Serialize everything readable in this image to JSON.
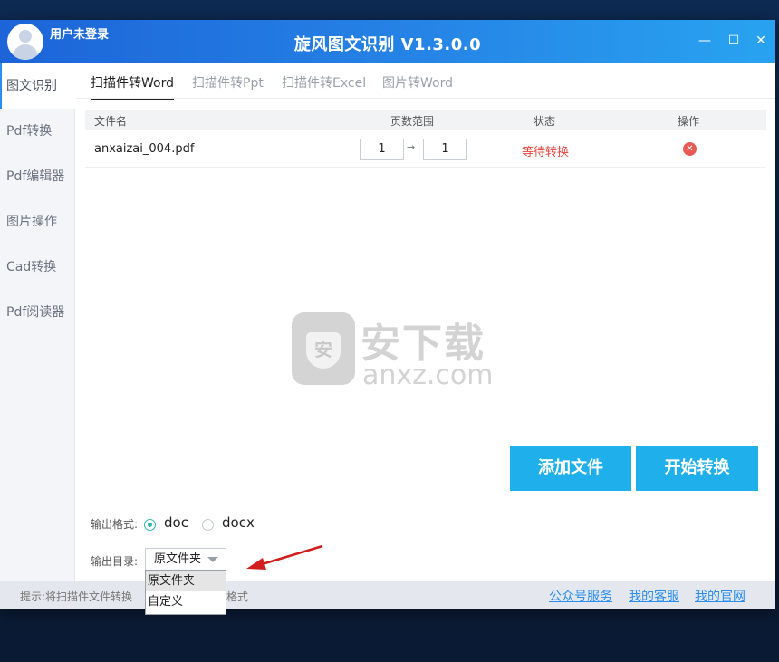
{
  "titlebar": {
    "user_name": "用户未登录",
    "app_title": "旋风图文识别 V1.3.0.0",
    "minimize_glyph": "—",
    "maximize_glyph": "☐",
    "close_glyph": "✕"
  },
  "sidebar": {
    "items": [
      {
        "label": "图文识别",
        "active": true
      },
      {
        "label": "Pdf转换"
      },
      {
        "label": "Pdf编辑器"
      },
      {
        "label": "图片操作"
      },
      {
        "label": "Cad转换"
      },
      {
        "label": "Pdf阅读器"
      }
    ]
  },
  "tabs": [
    {
      "label": "扫描件转Word",
      "active": true
    },
    {
      "label": "扫描件转Ppt"
    },
    {
      "label": "扫描件转Excel"
    },
    {
      "label": "图片转Word"
    }
  ],
  "table": {
    "columns": [
      "文件名",
      "页数范围",
      "状态",
      "操作"
    ],
    "rows": [
      {
        "file": "anxaizai_004.pdf",
        "page_from": "1",
        "page_to": "1",
        "status": "等待转换"
      }
    ]
  },
  "watermark": {
    "cn": "安下载",
    "en": "anxz.com",
    "shield_glyph": "安"
  },
  "buttons": {
    "add_file": "添加文件",
    "start_convert": "开始转换"
  },
  "output_format": {
    "label": "输出格式:",
    "options": [
      "doc",
      "docx"
    ],
    "selected": "doc"
  },
  "output_dir": {
    "label": "输出目录:",
    "value": "原文件夹",
    "options": [
      "原文件夹",
      "自定义"
    ]
  },
  "footer": {
    "tip_start": "提示:将扫描件文件转换",
    "tip_end": "格式",
    "links": [
      "公众号服务",
      "我的客服",
      "我的官网"
    ]
  },
  "colors": {
    "accent": "#1fb0ec",
    "status_waiting": "#e8453c",
    "link": "#2a8ef0"
  }
}
